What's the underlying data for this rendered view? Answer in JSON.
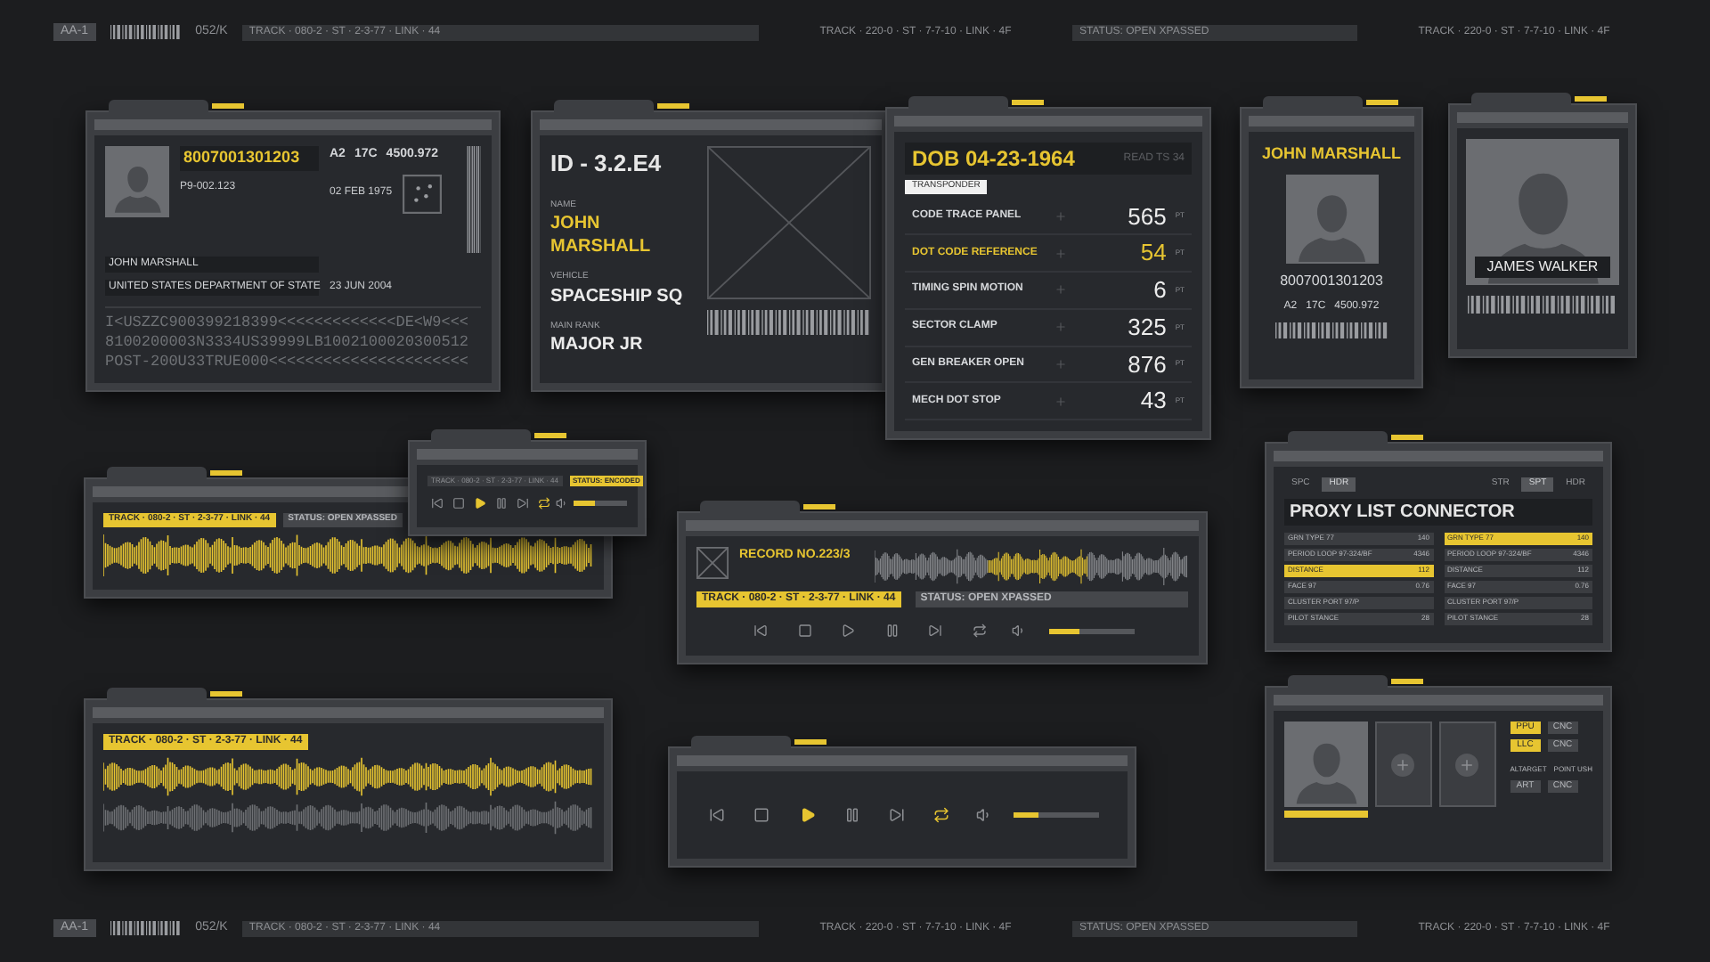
{
  "top_bar": {
    "code": "AA-1",
    "ref": "052/K",
    "segments": [
      "TRACK · 080-2 · ST · 2-3-77 · LINK · 44",
      "TRACK · 220-0 · ST · 7-7-10 · LINK · 4F",
      "STATUS: OPEN XPASSED",
      "TRACK · 220-0 · ST · 7-7-10 · LINK · 4F"
    ]
  },
  "passport": {
    "number": "8007001301203",
    "code": "P9-002.123",
    "specs": [
      "A2",
      "17C",
      "4500.972"
    ],
    "birth": "02 FEB 1975",
    "name": "JOHN MARSHALL",
    "issuer": "UNITED STATES DEPARTMENT OF STATE",
    "issued": "23 JUN 2004",
    "mrz": [
      "I<USZZC900399218399<<<<<<<<<<<<<DE<W9<<<",
      "8100200003N3334US39999LB1002100020300512",
      "POST-200U33TRUE000<<<<<<<<<<<<<<<<<<<<<<"
    ]
  },
  "id_card": {
    "id": "ID - 3.2.E4",
    "fields": [
      {
        "label": "NAME",
        "value": "JOHN MARSHALL",
        "accent": true
      },
      {
        "label": "VEHICLE",
        "value": "SPACESHIP SQ",
        "accent": false
      },
      {
        "label": "MAIN RANK",
        "value": "MAJOR JR",
        "accent": false
      }
    ]
  },
  "dob_card": {
    "title": "DOB 04-23-1964",
    "reading": "READ TS 34",
    "tabs": [
      {
        "label": "TRANSPONDER",
        "selected": true
      }
    ],
    "rows": [
      {
        "name": "CODE TRACE PANEL",
        "value": "565",
        "unit": "PT",
        "selected": false
      },
      {
        "name": "DOT CODE REFERENCE",
        "value": "54",
        "unit": "PT",
        "selected": true
      },
      {
        "name": "TIMING SPIN MOTION",
        "value": "6",
        "unit": "PT",
        "selected": false
      },
      {
        "name": "SECTOR CLAMP",
        "value": "325",
        "unit": "PT",
        "selected": false
      },
      {
        "name": "GEN BREAKER OPEN",
        "value": "876",
        "unit": "PT",
        "selected": false
      },
      {
        "name": "MECH DOT STOP",
        "value": "43",
        "unit": "PT",
        "selected": false
      }
    ]
  },
  "badge_card": {
    "name": "JOHN MARSHALL",
    "number": "8007001301203",
    "specs": [
      "A2",
      "17C",
      "4500.972"
    ]
  },
  "portrait_card": {
    "name": "JAMES WALKER"
  },
  "wave_panel": {
    "track": "TRACK · 080-2 · ST · 2-3-77 · LINK · 44",
    "status": "STATUS: OPEN XPASSED"
  },
  "mini_player": {
    "track": "TRACK · 080-2 · ST · 2-3-77 · LINK · 44",
    "status": "STATUS: ENCODED",
    "controls": [
      {
        "kind": "previous",
        "active": false
      },
      {
        "kind": "stop",
        "active": false
      },
      {
        "kind": "play",
        "active": true
      },
      {
        "kind": "pause",
        "active": false
      },
      {
        "kind": "next",
        "active": false
      },
      {
        "kind": "repeat",
        "active": true
      }
    ],
    "volume": {
      "level": 0.4
    }
  },
  "record_panel": {
    "title": "RECORD NO.223/3",
    "track": "TRACK · 080-2 · ST · 2-3-77 · LINK · 44",
    "status": "STATUS: OPEN XPASSED",
    "controls": [
      {
        "kind": "previous",
        "active": false
      },
      {
        "kind": "stop",
        "active": false
      },
      {
        "kind": "play",
        "active": false
      },
      {
        "kind": "pause",
        "active": false
      },
      {
        "kind": "next",
        "active": false
      },
      {
        "kind": "repeat",
        "active": false
      }
    ],
    "volume": {
      "level": 0.35
    }
  },
  "proxy_panel": {
    "toggle_groups": [
      [
        {
          "label": "SPC",
          "selected": false
        },
        {
          "label": "HDR",
          "selected": true
        }
      ],
      [
        {
          "label": "STR",
          "selected": false
        },
        {
          "label": "SPT",
          "selected": true
        },
        {
          "label": "HDR",
          "selected": false
        }
      ]
    ],
    "title": "PROXY LIST CONNECTOR",
    "columns": [
      [
        {
          "label": "GRN TYPE 77",
          "value": "140",
          "selected": false
        },
        {
          "label": "PERIOD LOOP 97-324/BF",
          "value": "4346",
          "selected": false
        },
        {
          "label": "DISTANCE",
          "value": "112",
          "selected": true
        },
        {
          "label": "FACE 97",
          "value": "0.76",
          "selected": false
        },
        {
          "label": "CLUSTER PORT 97/P",
          "selected": false
        },
        {
          "label": "PILOT STANCE",
          "value": "28",
          "selected": false
        }
      ],
      [
        {
          "label": "GRN TYPE 77",
          "value": "140",
          "selected": true
        },
        {
          "label": "PERIOD LOOP 97-324/BF",
          "value": "4346",
          "selected": false
        },
        {
          "label": "DISTANCE",
          "value": "112",
          "selected": false
        },
        {
          "label": "FACE 97",
          "value": "0.76",
          "selected": false
        },
        {
          "label": "CLUSTER PORT 97/P",
          "selected": false
        },
        {
          "label": "PILOT STANCE",
          "value": "28",
          "selected": false
        }
      ]
    ]
  },
  "profile_panel": {
    "button_rows": [
      [
        {
          "label": "PPU",
          "selected": true
        },
        {
          "label": "CNC",
          "selected": false
        }
      ],
      [
        {
          "label": "LLC",
          "selected": true
        },
        {
          "label": "CNC",
          "selected": false
        }
      ]
    ],
    "labels": [
      "ALTARGET",
      "POINT USH"
    ],
    "actions": [
      {
        "label": "ART",
        "selected": false
      },
      {
        "label": "CNC",
        "selected": false
      }
    ]
  },
  "dual_wave_panel": {
    "track": "TRACK · 080-2 · ST · 2-3-77 · LINK · 44"
  },
  "player_bar": {
    "controls": [
      {
        "kind": "previous",
        "active": false
      },
      {
        "kind": "stop",
        "active": false
      },
      {
        "kind": "play",
        "active": true
      },
      {
        "kind": "pause",
        "active": false
      },
      {
        "kind": "next",
        "active": false
      },
      {
        "kind": "repeat",
        "active": true
      }
    ],
    "volume": {
      "level": 0.3
    }
  },
  "bottom_bar": {
    "code": "AA-1",
    "ref": "052/K",
    "segments": [
      "TRACK · 080-2 · ST · 2-3-77 · LINK · 44",
      "TRACK · 220-0 · ST · 7-7-10 · LINK · 4F",
      "STATUS: OPEN XPASSED",
      "TRACK · 220-0 · ST · 7-7-10 · LINK · 4F"
    ]
  }
}
